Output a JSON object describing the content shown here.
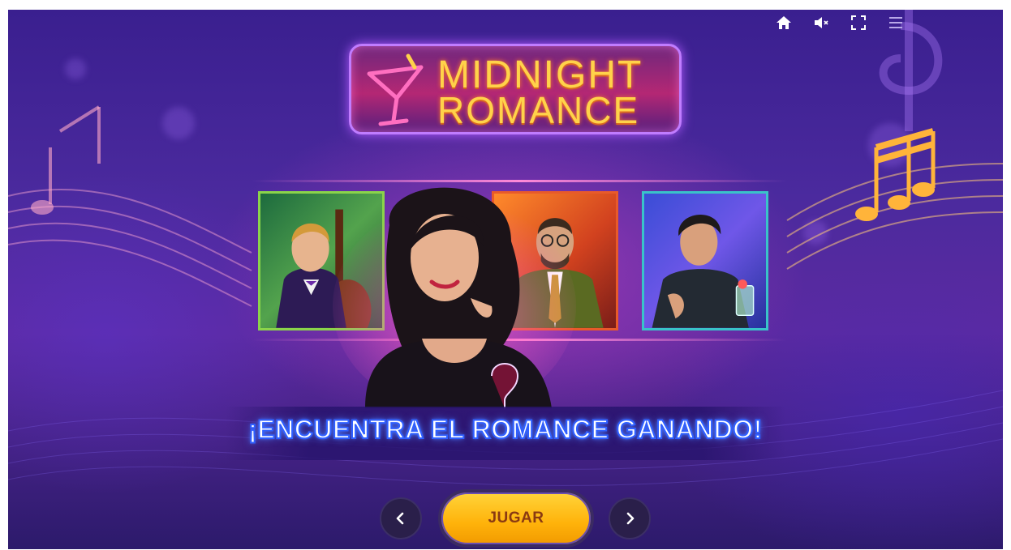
{
  "game": {
    "logo": {
      "line1": "MIDNIGHT",
      "line2": "ROMANCE"
    },
    "tagline": "¡ENCUENTRA EL ROMANCE GANANDO!",
    "play_label": "JUGAR",
    "toolbar": {
      "icons": [
        "home-icon",
        "mute-icon",
        "fullscreen-icon",
        "menu-icon"
      ]
    },
    "navigation": {
      "prev_icon": "chevron-left-icon",
      "next_icon": "chevron-right-icon"
    },
    "characters": [
      "bassist-card",
      "lady-character",
      "gentleman-glasses-card",
      "bartender-card"
    ],
    "colors": {
      "logo_text": "#ffd24a",
      "tagline_stroke": "#2f5fff",
      "play_button": "#ffc21f",
      "background": "#4b2a9e"
    }
  }
}
